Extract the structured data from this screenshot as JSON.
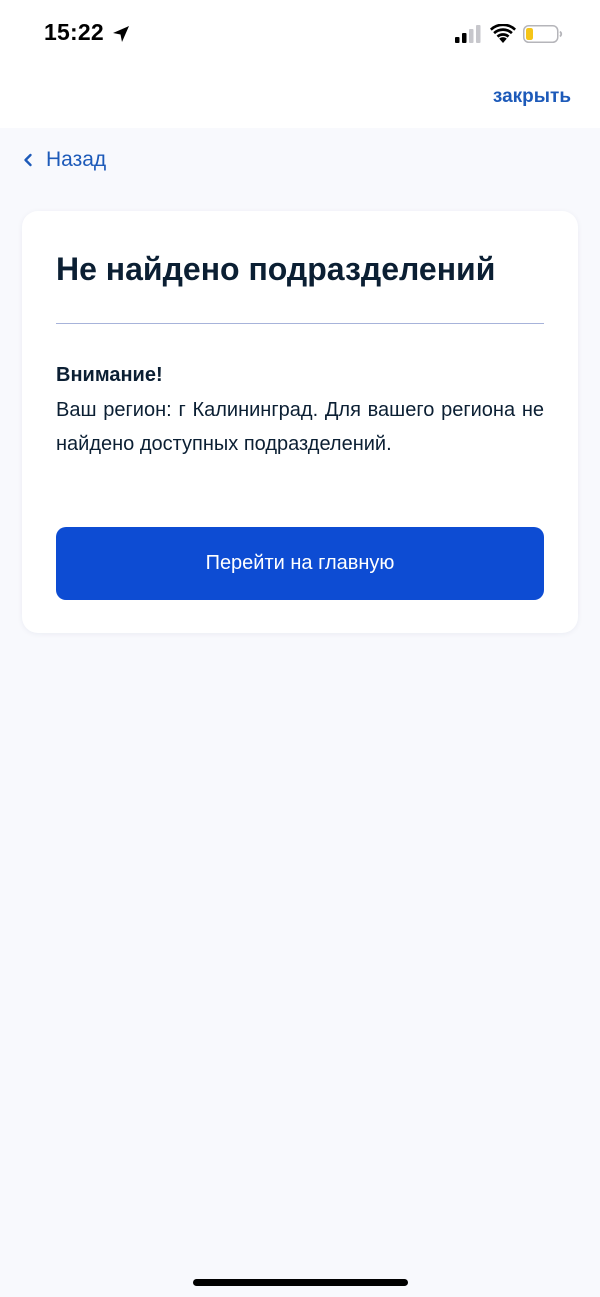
{
  "status_bar": {
    "time": "15:22",
    "icons": [
      "location-arrow-icon",
      "cellular-signal-icon",
      "wifi-icon",
      "battery-low-icon"
    ],
    "battery_color": "#f5c518"
  },
  "header": {
    "close_label": "закрыть"
  },
  "nav": {
    "back_label": "Назад"
  },
  "card": {
    "title": "Не найдено подразделений",
    "notice_heading": "Внимание!",
    "notice_text": "Ваш регион: г Калининград. Для вашего региона не найдено доступных подразделений.",
    "button_label": "Перейти на главную"
  },
  "colors": {
    "accent": "#0d4cd3",
    "link": "#1d5ab9",
    "text": "#0b1f33",
    "background": "#f8f9fd"
  }
}
